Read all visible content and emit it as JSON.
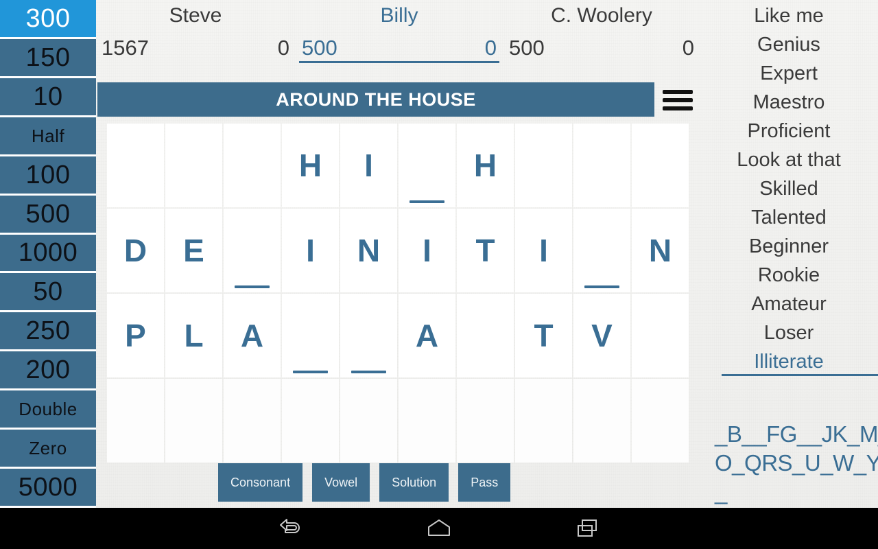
{
  "wheel": {
    "values": [
      {
        "label": "300",
        "selected": true,
        "word": false
      },
      {
        "label": "150",
        "selected": false,
        "word": false
      },
      {
        "label": "10",
        "selected": false,
        "word": false
      },
      {
        "label": "Half",
        "selected": false,
        "word": true
      },
      {
        "label": "100",
        "selected": false,
        "word": false
      },
      {
        "label": "500",
        "selected": false,
        "word": false
      },
      {
        "label": "1000",
        "selected": false,
        "word": false
      },
      {
        "label": "50",
        "selected": false,
        "word": false
      },
      {
        "label": "250",
        "selected": false,
        "word": false
      },
      {
        "label": "200",
        "selected": false,
        "word": false
      },
      {
        "label": "Double",
        "selected": false,
        "word": true
      },
      {
        "label": "Zero",
        "selected": false,
        "word": true
      },
      {
        "label": "5000",
        "selected": false,
        "word": false
      }
    ],
    "selected_value": "300"
  },
  "scoreboard": {
    "players": [
      {
        "name": "Steve",
        "total": "1567",
        "round": "0",
        "active": false
      },
      {
        "name": "Billy",
        "total": "500",
        "round": "0",
        "active": true
      },
      {
        "name": "C. Woolery",
        "total": "500",
        "round": "0",
        "active": false
      }
    ]
  },
  "puzzle": {
    "category": "AROUND THE HOUSE",
    "menu_icon": "hamburger-menu-icon",
    "rows": [
      [
        {
          "letter": "",
          "cursor": false
        },
        {
          "letter": "",
          "cursor": false
        },
        {
          "letter": "",
          "cursor": false
        },
        {
          "letter": "H",
          "cursor": false
        },
        {
          "letter": "I",
          "cursor": false
        },
        {
          "letter": "",
          "cursor": true
        },
        {
          "letter": "H",
          "cursor": false
        },
        {
          "letter": "",
          "cursor": false
        },
        {
          "letter": "",
          "cursor": false
        },
        {
          "letter": "",
          "cursor": false
        }
      ],
      [
        {
          "letter": "D",
          "cursor": false
        },
        {
          "letter": "E",
          "cursor": false
        },
        {
          "letter": "",
          "cursor": true
        },
        {
          "letter": "I",
          "cursor": false
        },
        {
          "letter": "N",
          "cursor": false
        },
        {
          "letter": "I",
          "cursor": false
        },
        {
          "letter": "T",
          "cursor": false
        },
        {
          "letter": "I",
          "cursor": false
        },
        {
          "letter": "",
          "cursor": true
        },
        {
          "letter": "N",
          "cursor": false
        }
      ],
      [
        {
          "letter": "P",
          "cursor": false
        },
        {
          "letter": "L",
          "cursor": false
        },
        {
          "letter": "A",
          "cursor": false
        },
        {
          "letter": "",
          "cursor": true
        },
        {
          "letter": "",
          "cursor": true
        },
        {
          "letter": "A",
          "cursor": false
        },
        {
          "letter": "",
          "cursor": false
        },
        {
          "letter": "T",
          "cursor": false
        },
        {
          "letter": "V",
          "cursor": false
        },
        {
          "letter": "",
          "cursor": false
        }
      ],
      [
        {
          "letter": "",
          "cursor": false
        },
        {
          "letter": "",
          "cursor": false
        },
        {
          "letter": "",
          "cursor": false
        },
        {
          "letter": "",
          "cursor": false
        },
        {
          "letter": "",
          "cursor": false
        },
        {
          "letter": "",
          "cursor": false
        },
        {
          "letter": "",
          "cursor": false
        },
        {
          "letter": "",
          "cursor": false
        },
        {
          "letter": "",
          "cursor": false
        },
        {
          "letter": "",
          "cursor": false
        }
      ]
    ]
  },
  "actions": {
    "consonant": "Consonant",
    "vowel": "Vowel",
    "solution": "Solution",
    "pass": "Pass"
  },
  "ranks": {
    "items": [
      {
        "label": "Like me",
        "selected": false
      },
      {
        "label": "Genius",
        "selected": false
      },
      {
        "label": "Expert",
        "selected": false
      },
      {
        "label": "Maestro",
        "selected": false
      },
      {
        "label": "Proficient",
        "selected": false
      },
      {
        "label": "Look at that",
        "selected": false
      },
      {
        "label": "Skilled",
        "selected": false
      },
      {
        "label": "Talented",
        "selected": false
      },
      {
        "label": "Beginner",
        "selected": false
      },
      {
        "label": "Rookie",
        "selected": false
      },
      {
        "label": "Amateur",
        "selected": false
      },
      {
        "label": "Loser",
        "selected": false
      },
      {
        "label": "Illiterate",
        "selected": true
      }
    ],
    "selected_label": "Illiterate"
  },
  "letter_tray": {
    "text": "_B__FG__JK_M_O_QRS_U_W_Y_"
  },
  "navbar": {
    "back": "back-icon",
    "home": "home-icon",
    "recents": "recents-icon"
  },
  "colors": {
    "panel_blue": "#3d6c8c",
    "accent_blue": "#2196d9",
    "letter_blue": "#3a6e94",
    "background": "#f2f2f0",
    "tile_white": "#ffffff"
  }
}
